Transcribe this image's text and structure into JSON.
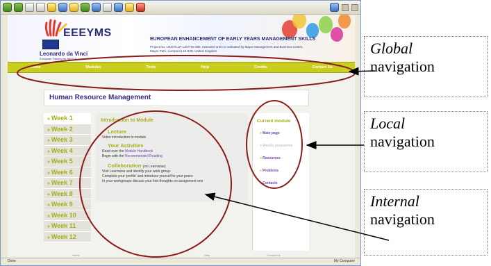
{
  "site": {
    "logo_text": "EEEYMS",
    "title": "EUROPEAN ENHANCEMENT OF EARLY YEARS MANAGEMENT SKILLS",
    "description": "Project No. UK/07/LLP-LdV/TOI-080, extended until co-ordinated by Mayor Management and Business Centre, Mayor Park, Liverpool L16 8JD, United Kingdom",
    "leonardo": "Leonardo da Vinci",
    "leonardo_sub": "European Training for the EU"
  },
  "nav": [
    "Home",
    "Modules",
    "Tools",
    "Help",
    "Credits",
    "Contact Us"
  ],
  "page_heading": "Human Resource Management",
  "weeks": [
    "Week 1",
    "Week 2",
    "Week 3",
    "Week 4",
    "Week 5",
    "Week 6",
    "Week 7",
    "Week 8",
    "Week 9",
    "Week 10",
    "Week 11",
    "Week 12"
  ],
  "content": {
    "title": "Introduction to Module",
    "lecture_title": "Lecture",
    "lecture_text": "Video introduction to module",
    "activities_title": "Your Activities",
    "activities_line1_pre": "Read over the ",
    "activities_line1_link": "Module Handbook",
    "activities_line2_pre": "Begin with the ",
    "activities_line2_link": "Recommended Reading",
    "collab_title": "Collaboration",
    "collab_suffix": "(on Learnwise)",
    "collab_line1": "Visit Learnwise and identify your work group.",
    "collab_line2": "Complete your 'profile' and introduce yourself to your peers",
    "collab_line3": "In your workgroups discuss your first thoughts on assignment one"
  },
  "current_module": {
    "title": "Current module",
    "items": [
      "Main page",
      "Weekly programme",
      "Resources",
      "Problems",
      "Contacts"
    ]
  },
  "footer": [
    "Home",
    "Modules",
    "Help",
    "Contact Us"
  ],
  "status": {
    "left": "Done",
    "right": "My Computer"
  },
  "callouts": {
    "global_italic": "Global",
    "global_rest": "navigation",
    "local_italic": "Local",
    "local_rest": "navigation",
    "internal_italic": "Internal",
    "internal_rest": "navigation"
  },
  "colors": {
    "nav_bar": "#c9cd1d",
    "accent_green": "#a6ae16",
    "heading_purple": "#3b2a8c",
    "link_purple": "#6a3fb0",
    "ellipse": "#8b1a1a"
  }
}
